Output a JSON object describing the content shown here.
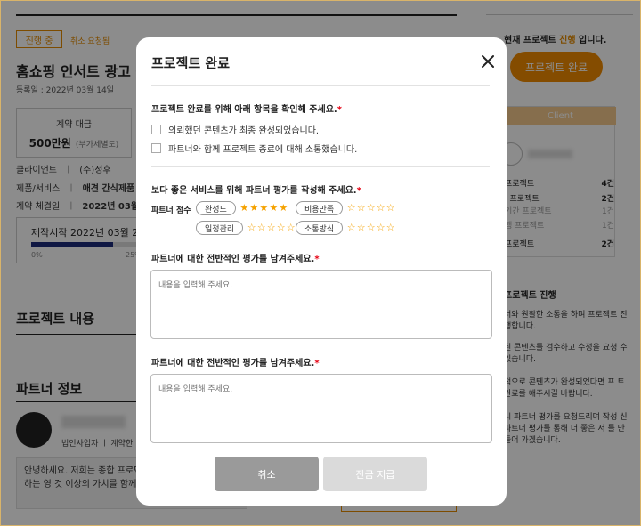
{
  "background": {
    "status_badge": "진행 중",
    "cancel_request": "취소 요청됨",
    "title": "홈쇼핑 인서트 광고 상",
    "reg_date": "등록일 : 2022년 03월 14일",
    "price_label": "계약 대금",
    "price_value": "500만원",
    "price_note": "(부가세별도)",
    "info": [
      {
        "label": "클라이언트",
        "value": "(주)정후"
      },
      {
        "label": "제품/서비스",
        "value": "애견 간식제품"
      },
      {
        "label": "계약 체결일",
        "value": "2022년 03월 2"
      }
    ],
    "prod_start": "제작시작 2022년 03월 22일",
    "progress": {
      "fill_fraction": 0.2,
      "label_start": "0%",
      "label_mid": "25%"
    },
    "section_content": "프로젝트 내용",
    "section_partner": "파트너 정보",
    "partner_meta": "법인사업자  ㅣ  계약한",
    "partner_intro": "안녕하세요. 저희는 종합 프로덕 항상 새로움을 찾고 도전하는 영 것 이상의 가치를 함께 만들어 드"
  },
  "right": {
    "status_prefix": "현재 프로젝트 ",
    "status_highlight": "진행",
    "status_suffix": " 입니다.",
    "complete_button": "프로젝트 완료",
    "client_tab": "Client",
    "stats": [
      {
        "label": "프로젝트",
        "value": "4건",
        "dim": false
      },
      {
        "label": "I 프로젝트",
        "value": "2건",
        "dim": false
      },
      {
        "label": "기간 프로젝트",
        "value": "1건",
        "dim": true
      },
      {
        "label": "행 프로젝트",
        "value": "1건",
        "dim": true
      },
      {
        "label": "프로젝트",
        "value": "2건",
        "dim": false
      }
    ],
    "block_title": "프로젝트 진행",
    "texts": [
      "너와 원활한 소통을 하며 프로젝트 진행합니다.",
      "된 콘텐츠를 검수하고 수정을 요청 수 있습니다.",
      "적으로 콘텐츠가 완성되었다면 프 트 완료를 해주시길 바랍니다.",
      "시 파트너 평가를 요청드리며 작성 신 파트너 평가를 통해 더 좋은 서 를 만들어 가겠습니다."
    ]
  },
  "modal": {
    "title": "프로젝트 완료",
    "check_title": "프로젝트 완료를 위해 아래 항목을 확인해 주세요.",
    "checks": [
      "의뢰했던 콘텐츠가 최종 완성되었습니다.",
      "파트너와 함께 프로젝트 종료에 대해 소통했습니다."
    ],
    "rating_title": "보다 좋은 서비스를 위해 파트너 평가를 작성해 주세요.",
    "rating_label": "파트너 점수",
    "ratings": [
      {
        "label": "완성도",
        "score": 5
      },
      {
        "label": "비용만족",
        "score": 0
      },
      {
        "label": "일정관리",
        "score": 0
      },
      {
        "label": "소통방식",
        "score": 0
      }
    ],
    "review_title_1": "파트너에 대한 전반적인 평가를 남겨주세요.",
    "review_title_2": "파트너에 대한 전반적인 평가를 남겨주세요.",
    "placeholder_1": "내용을 입력해 주세요.",
    "placeholder_2": "내용을 입력해 주세요.",
    "cancel_button": "취소",
    "submit_button": "잔금 지급",
    "required_mark": "*"
  },
  "colors": {
    "accent": "#f08a00",
    "required": "#e60012",
    "star": "#f5a200"
  }
}
